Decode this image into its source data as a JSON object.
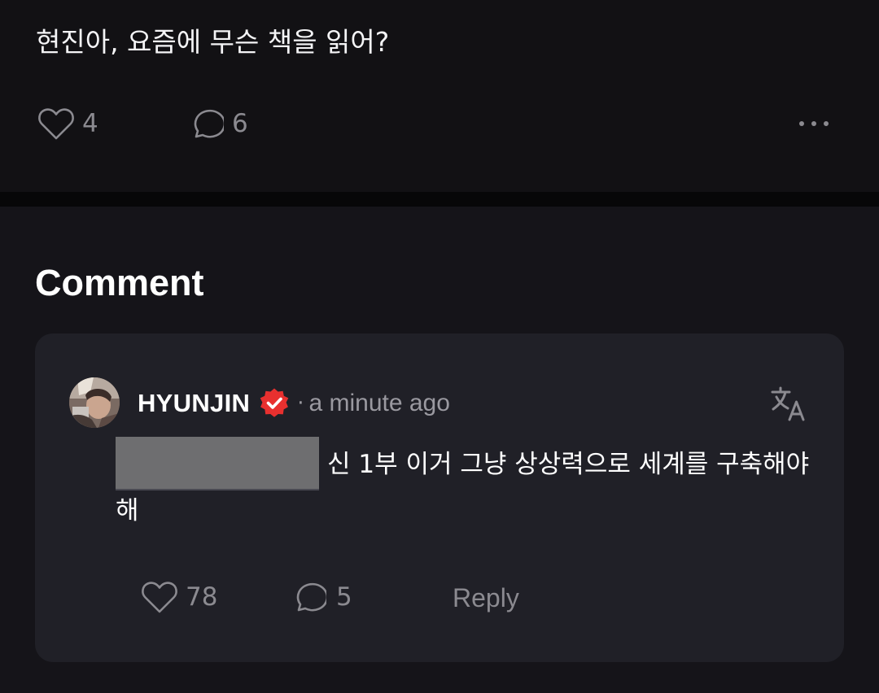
{
  "post": {
    "text": "현진아, 요즘에 무슨 책을 읽어?",
    "likes": "4",
    "comments": "6"
  },
  "comment_section": {
    "title": "Comment"
  },
  "comment": {
    "author": "HYUNJIN",
    "separator": "·",
    "timestamp": "a minute ago",
    "text": "신 1부 이거 그냥 상상력으로 세계를 구축해야해",
    "likes": "78",
    "replies": "5",
    "reply_label": "Reply"
  },
  "icons": {
    "like": "heart-outline-icon",
    "comment": "speech-bubble-icon",
    "more": "more-dots-icon",
    "verified": "verified-badge-icon",
    "translate": "translate-icon"
  },
  "colors": {
    "background": "#121114",
    "card": "#202027",
    "verified_badge": "#e8302f",
    "muted_text": "#8b8a90"
  }
}
